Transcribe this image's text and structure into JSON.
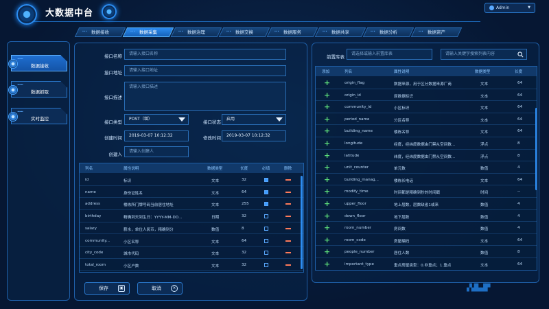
{
  "app": {
    "title": "大数据中台",
    "user": "Admin"
  },
  "nav": [
    "数据接收",
    "数据采集",
    "数据治理",
    "数据交换",
    "数据服务",
    "数据共享",
    "数据分析",
    "数据资产"
  ],
  "nav_active": 1,
  "side": [
    "数据接收",
    "数据抓取",
    "实时监控"
  ],
  "side_active": 0,
  "form": {
    "name_label": "接口名称",
    "name_placeholder": "请输入接口名称",
    "addr_label": "接口地址",
    "addr_placeholder": "请输入接口地址",
    "desc_label": "接口描述",
    "desc_placeholder": "请输入接口描述",
    "type_label": "接口类型",
    "type_value": "POST（增）",
    "status_label": "接口状态",
    "status_value": "启用",
    "created_label": "创建时间",
    "created_value": "2019-03-07 10:12:32",
    "modified_label": "修改时间",
    "modified_value": "2019-03-07 10:12:32",
    "creator_label": "创建人",
    "creator_placeholder": "请输入创建人"
  },
  "left_table": {
    "headers": [
      "列名",
      "属性说明",
      "数据类型",
      "长度",
      "必填",
      "删除"
    ],
    "rows": [
      {
        "name": "id",
        "desc": "标识",
        "type": "文本",
        "len": "32",
        "req": true
      },
      {
        "name": "name",
        "desc": "身份证姓名",
        "type": "文本",
        "len": "64",
        "req": true
      },
      {
        "name": "address",
        "desc": "楼栋所门牌号码当前居住地址",
        "type": "文本",
        "len": "255",
        "req": true
      },
      {
        "name": "birthday",
        "desc": "精确到天到生日：YYYY-MM-DD...",
        "type": "日期",
        "len": "32",
        "req": false
      },
      {
        "name": "salary",
        "desc": "薪水，单位人民币，精确到分",
        "type": "数值",
        "len": "8",
        "req": false
      },
      {
        "name": "community...",
        "desc": "小区名称",
        "type": "文本",
        "len": "64",
        "req": false
      },
      {
        "name": "city_code",
        "desc": "城市代码",
        "type": "文本",
        "len": "32",
        "req": false
      },
      {
        "name": "total_room",
        "desc": "小区户数",
        "type": "文本",
        "len": "32",
        "req": false
      }
    ]
  },
  "buttons": {
    "save": "保存",
    "cancel": "取消"
  },
  "right": {
    "db_label": "前置库表",
    "db_placeholder": "请选择或输入前置库表",
    "search_placeholder": "请输入关键字搜索列表内容",
    "headers": [
      "添加",
      "列名",
      "属性说明",
      "数据类型",
      "长度"
    ],
    "rows": [
      {
        "name": "origin_flag",
        "desc": "数据来源，用于区分数据来源厂商",
        "type": "文本",
        "len": "64"
      },
      {
        "name": "origin_id",
        "desc": "原数据标识",
        "type": "文本",
        "len": "64"
      },
      {
        "name": "community_id",
        "desc": "小区标识",
        "type": "文本",
        "len": "64"
      },
      {
        "name": "period_name",
        "desc": "分区名称",
        "type": "文本",
        "len": "64"
      },
      {
        "name": "building_name",
        "desc": "楼栋名称",
        "type": "文本",
        "len": "64"
      },
      {
        "name": "longitude",
        "desc": "经度，经纬度数据由门禁从空间数...",
        "type": "浮点",
        "len": "8"
      },
      {
        "name": "latitude",
        "desc": "纬度，经纬度数据由门禁从空间数...",
        "type": "浮点",
        "len": "8"
      },
      {
        "name": "unit_counter",
        "desc": "单元数",
        "type": "数值",
        "len": "4"
      },
      {
        "name": "building_manag...",
        "desc": "楼栋长电话",
        "type": "文本",
        "len": "64"
      },
      {
        "name": "modify_time",
        "desc": "时间都是精确到秒的时间戳",
        "type": "时间",
        "len": "--"
      },
      {
        "name": "upper_floor",
        "desc": "地上层数，层数缺省1或来",
        "type": "数值",
        "len": "4"
      },
      {
        "name": "down_floor",
        "desc": "地下层数",
        "type": "数值",
        "len": "4"
      },
      {
        "name": "room_number",
        "desc": "房间数",
        "type": "数值",
        "len": "4"
      },
      {
        "name": "room_code",
        "desc": "房屋编码",
        "type": "文本",
        "len": "64"
      },
      {
        "name": "people_number",
        "desc": "居住人数",
        "type": "数值",
        "len": "8"
      },
      {
        "name": "important_type",
        "desc": "重点房屋类型：0.非重点；1.重点",
        "type": "文本",
        "len": "64"
      }
    ]
  },
  "colors": {
    "accent": "#2d8cf0",
    "background": "#071a33",
    "add": "#5ee07a",
    "delete": "#ff7b5a"
  }
}
